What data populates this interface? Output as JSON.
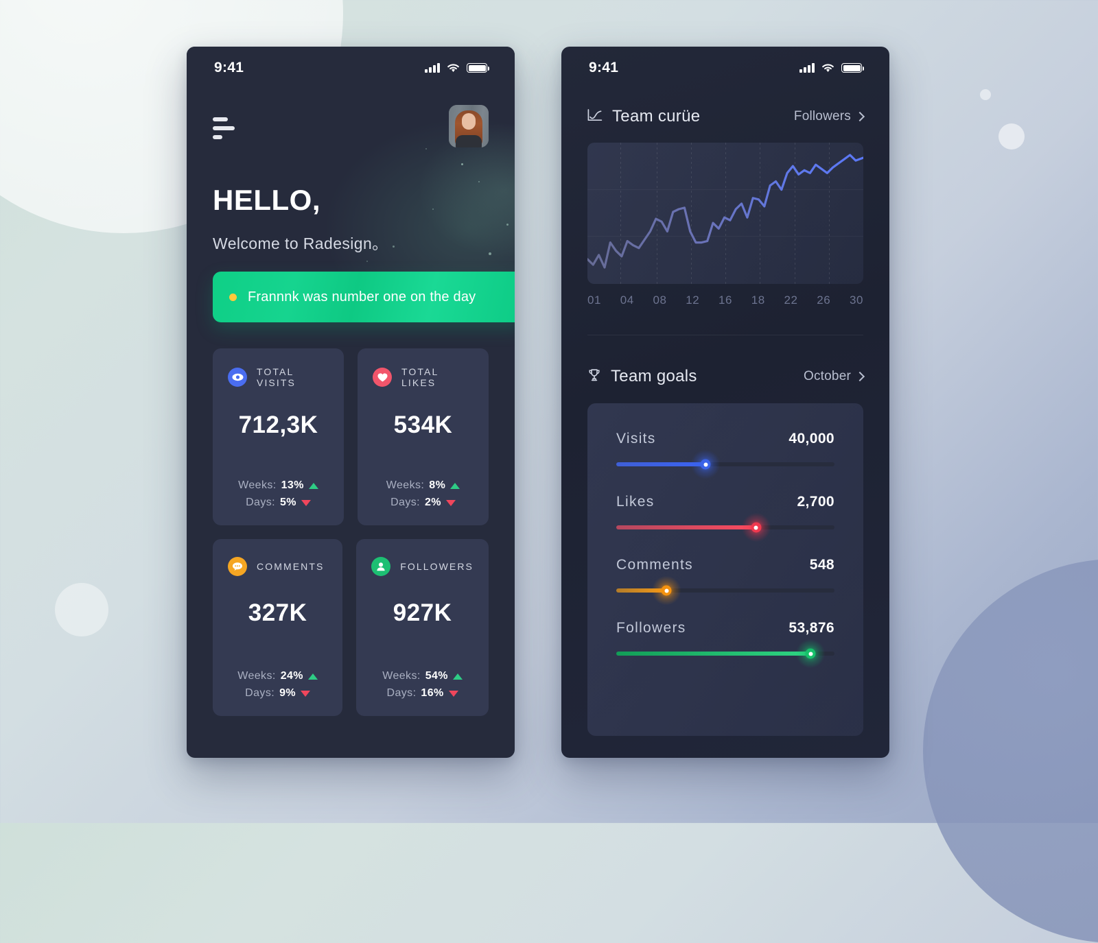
{
  "left_phone": {
    "status": {
      "time": "9:41",
      "signal_icon": "cellular-bars-icon",
      "wifi_icon": "wifi-icon",
      "battery_icon": "battery-full-icon"
    },
    "menu_icon": "hamburger-menu-icon",
    "avatar_alt": "user-avatar",
    "greeting": "HELLO,",
    "subtitle": "Welcome to Radesign。",
    "banner": {
      "text": "Frannnk was number one on the day",
      "dot_color": "#ffc93c",
      "bg_color": "#10cf87"
    },
    "cards": [
      {
        "label": "TOTAL VISITS",
        "value": "712,3K",
        "icon": "eye-icon",
        "icon_color": "#4a6df0",
        "weeks_key": "Weeks:",
        "weeks_value": "13%",
        "weeks_dir": "up",
        "days_key": "Days:",
        "days_value": "5%",
        "days_dir": "down"
      },
      {
        "label": "TOTAL LIKES",
        "value": "534K",
        "icon": "heart-icon",
        "icon_color": "#f2556b",
        "weeks_key": "Weeks:",
        "weeks_value": "8%",
        "weeks_dir": "up",
        "days_key": "Days:",
        "days_value": "2%",
        "days_dir": "down"
      },
      {
        "label": "COMMENTS",
        "value": "327K",
        "icon": "comment-bubble-icon",
        "icon_color": "#f5a623",
        "weeks_key": "Weeks:",
        "weeks_value": "24%",
        "weeks_dir": "up",
        "days_key": "Days:",
        "days_value": "9%",
        "days_dir": "down"
      },
      {
        "label": "FOLLOWERS",
        "value": "927K",
        "icon": "person-icon",
        "icon_color": "#1dbf73",
        "weeks_key": "Weeks:",
        "weeks_value": "54%",
        "weeks_dir": "up",
        "days_key": "Days:",
        "days_value": "16%",
        "days_dir": "down"
      }
    ]
  },
  "right_phone": {
    "status": {
      "time": "9:41",
      "signal_icon": "cellular-bars-icon",
      "wifi_icon": "wifi-icon",
      "battery_icon": "battery-full-icon"
    },
    "chart_section": {
      "title": "Team curüe",
      "icon": "line-chart-icon",
      "more_label": "Followers",
      "more_icon": "chevron-right-icon"
    },
    "goals_section": {
      "title": "Team goals",
      "icon": "trophy-icon",
      "more_label": "October",
      "more_icon": "chevron-right-icon"
    },
    "goals": [
      {
        "name": "Visits",
        "value": "40,000",
        "percent": 41,
        "color": "#3b63e8",
        "fill_from": "#3f5fd6",
        "fill_to": "#3b63f0"
      },
      {
        "name": "Likes",
        "value": "2,700",
        "percent": 64,
        "color": "#f0394f",
        "fill_from": "#b5485f",
        "fill_to": "#fb4b5f"
      },
      {
        "name": "Comments",
        "value": "548",
        "percent": 23,
        "color": "#f5920f",
        "fill_from": "#b27c2a",
        "fill_to": "#f59a18"
      },
      {
        "name": "Followers",
        "value": "53,876",
        "percent": 89,
        "color": "#17c06a",
        "fill_from": "#129d57",
        "fill_to": "#2fd583"
      }
    ]
  },
  "chart_data": {
    "type": "line",
    "title": "Team curüe",
    "series_name": "Followers",
    "xlabel": "",
    "ylabel": "",
    "grid": true,
    "legend": "none",
    "tick_labels": [
      "01",
      "04",
      "08",
      "12",
      "16",
      "18",
      "22",
      "26",
      "30"
    ],
    "xlim": [
      1,
      30
    ],
    "ylim": [
      0,
      100
    ],
    "x": [
      1,
      1.6,
      2.2,
      2.8,
      3.4,
      4,
      4.6,
      5.2,
      5.8,
      6.4,
      7,
      7.6,
      8.2,
      8.8,
      9.4,
      10,
      10.6,
      11.2,
      11.8,
      12.4,
      13,
      13.6,
      14.2,
      14.8,
      15.4,
      16,
      16.6,
      17.2,
      17.8,
      18.4,
      19,
      19.6,
      20.2,
      20.8,
      21.4,
      22,
      22.6,
      23.2,
      23.8,
      24.4,
      25,
      25.6,
      26.2,
      26.8,
      27.4,
      28,
      28.6,
      29.2,
      30
    ],
    "y": [
      18,
      14,
      21,
      12,
      30,
      24,
      20,
      31,
      28,
      26,
      32,
      38,
      47,
      45,
      38,
      52,
      54,
      55,
      38,
      30,
      30,
      31,
      44,
      40,
      48,
      46,
      54,
      58,
      48,
      62,
      61,
      56,
      71,
      74,
      68,
      80,
      85,
      79,
      82,
      80,
      86,
      83,
      80,
      84,
      87,
      90,
      93,
      89,
      91
    ],
    "line_color_start": "#6d719b",
    "line_color_end": "#5b78f6"
  }
}
